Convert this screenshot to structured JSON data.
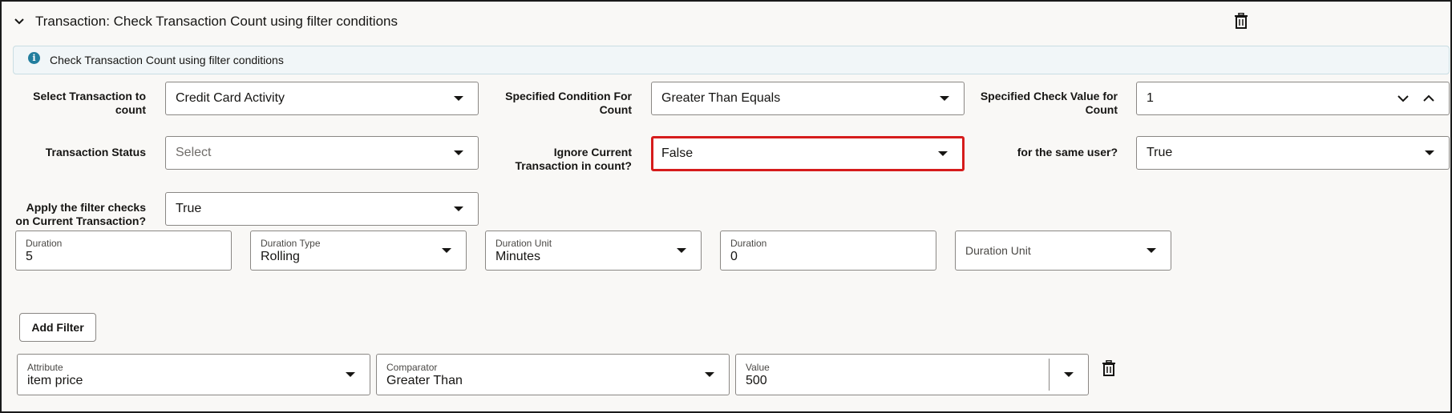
{
  "header": {
    "title": "Transaction: Check Transaction Count using filter conditions"
  },
  "info": {
    "text": "Check Transaction Count using filter conditions"
  },
  "row1": {
    "select_transaction_label": "Select Transaction to count",
    "select_transaction_value": "Credit Card Activity",
    "condition_label": "Specified Condition For Count",
    "condition_value": "Greater Than Equals",
    "check_value_label": "Specified Check Value for Count",
    "check_value_value": "1"
  },
  "row2": {
    "status_label": "Transaction Status",
    "status_placeholder": "Select",
    "ignore_label": "Ignore Current Transaction in count?",
    "ignore_value": "False",
    "same_user_label": "for the same user?",
    "same_user_value": "True"
  },
  "row3": {
    "apply_label": "Apply the filter checks on Current Transaction?",
    "apply_value": "True"
  },
  "duration_row": {
    "duration_label": "Duration",
    "duration_value": "5",
    "type_label": "Duration Type",
    "type_value": "Rolling",
    "unit_label": "Duration Unit",
    "unit_value": "Minutes",
    "duration2_label": "Duration",
    "duration2_value": "0",
    "unit2_label": "Duration Unit"
  },
  "add_filter_label": "Add Filter",
  "filter": {
    "attribute_label": "Attribute",
    "attribute_value": "item price",
    "comparator_label": "Comparator",
    "comparator_value": "Greater Than",
    "value_label": "Value",
    "value_value": "500"
  },
  "colors": {
    "highlight": "#d61c1c",
    "info_icon": "#227e9e",
    "panel_bg": "#f9f8f6"
  }
}
